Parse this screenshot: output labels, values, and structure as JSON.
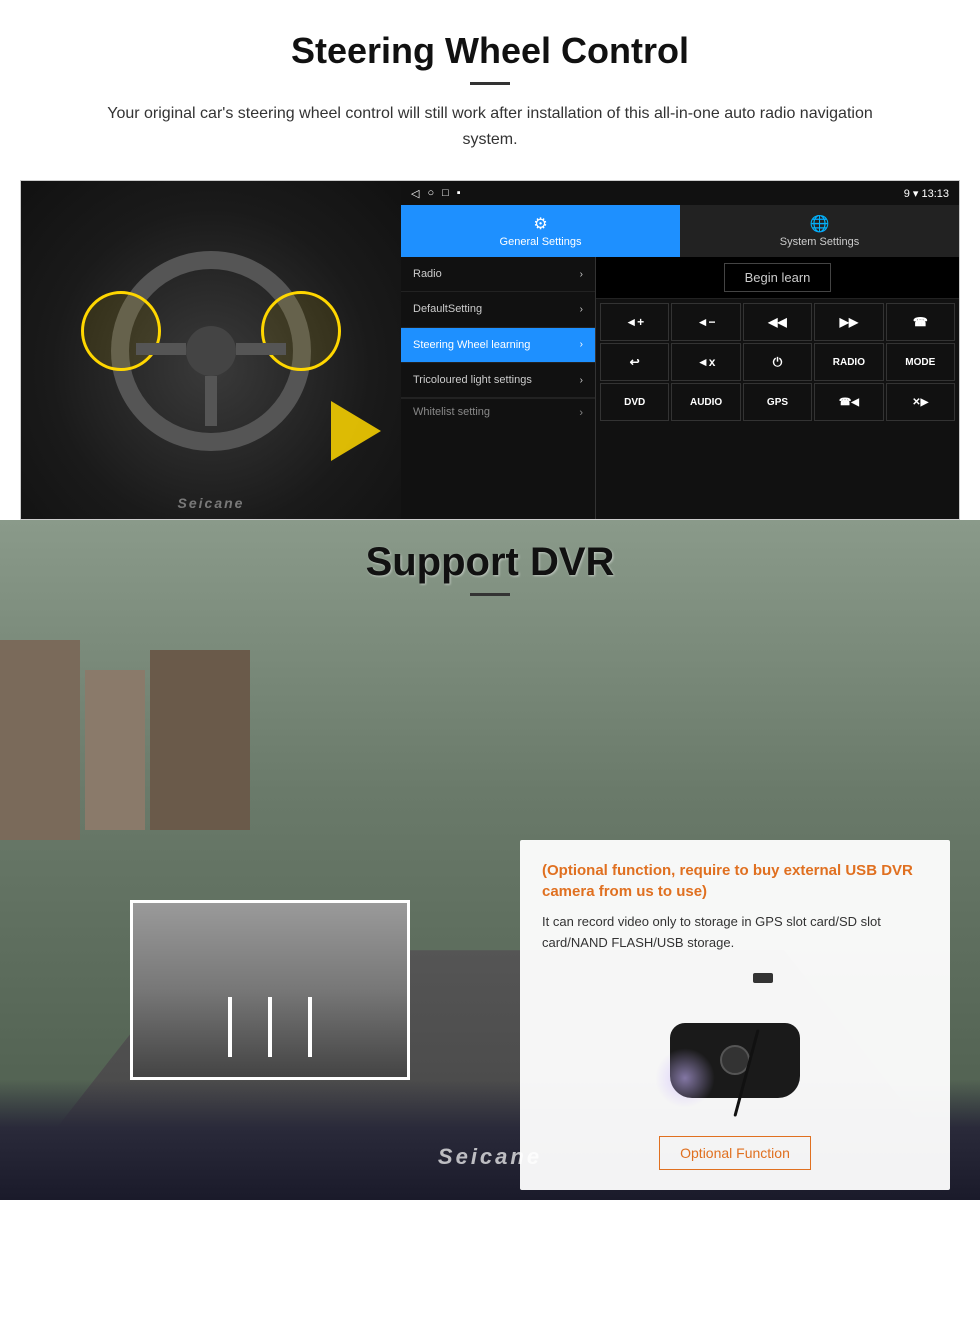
{
  "steering_section": {
    "title": "Steering Wheel Control",
    "description": "Your original car's steering wheel control will still work after installation of this all-in-one auto radio navigation system.",
    "status_bar": {
      "time": "13:13",
      "icons": "9 ▾"
    },
    "tabs": {
      "general": {
        "label": "General Settings",
        "icon": "⚙"
      },
      "system": {
        "label": "System Settings",
        "icon": "🌐"
      }
    },
    "menu_items": [
      {
        "label": "Radio",
        "active": false
      },
      {
        "label": "DefaultSetting",
        "active": false
      },
      {
        "label": "Steering Wheel learning",
        "active": true
      },
      {
        "label": "Tricoloured light settings",
        "active": false
      },
      {
        "label": "Whitelist setting",
        "active": false
      }
    ],
    "begin_learn_label": "Begin learn",
    "control_buttons": [
      "◄+",
      "◄-",
      "◄◄",
      "▶▶",
      "☎",
      "↩",
      "◄x",
      "⏻",
      "RADIO",
      "MODE",
      "DVD",
      "AUDIO",
      "GPS",
      "☎◄◄",
      "✕▶▶"
    ]
  },
  "dvr_section": {
    "title": "Support DVR",
    "optional_text": "(Optional function, require to buy external USB DVR camera from us to use)",
    "description": "It can record video only to storage in GPS slot card/SD slot card/NAND FLASH/USB storage.",
    "optional_function_label": "Optional Function",
    "seicane_label": "Seicane"
  }
}
